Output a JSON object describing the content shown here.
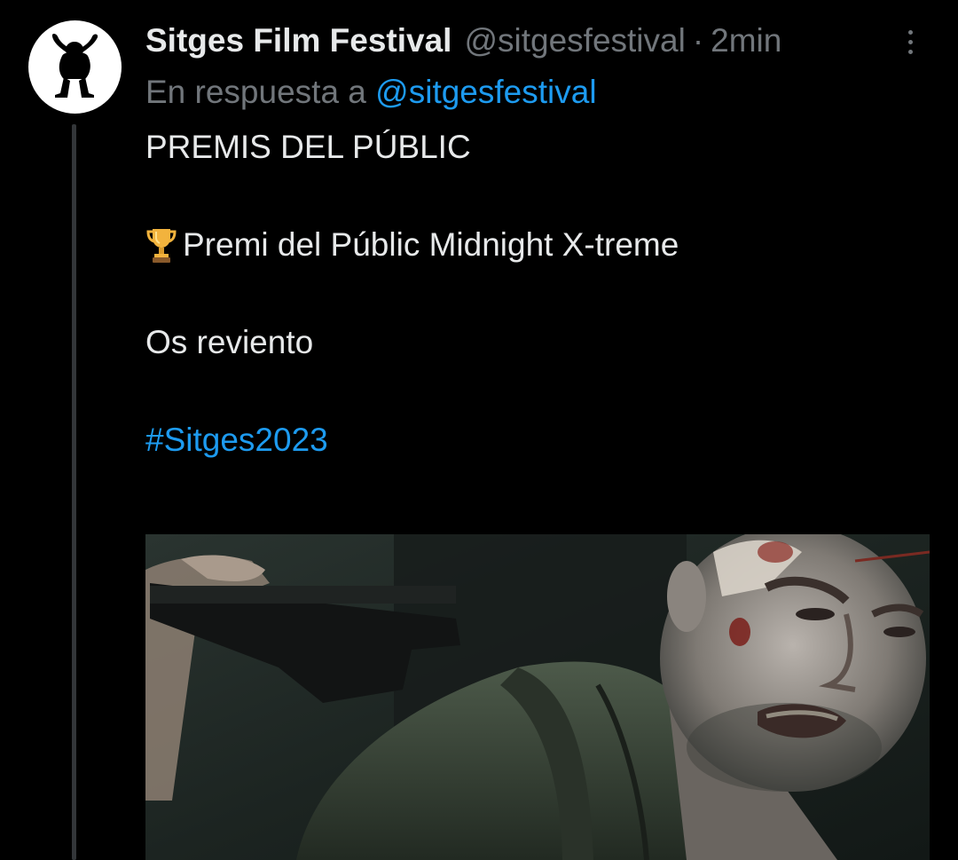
{
  "tweet": {
    "display_name": "Sitges Film Festival",
    "handle": "@sitgesfestival",
    "separator": "·",
    "time": "2min",
    "reply_prefix": "En respuesta a",
    "reply_to": "@sitgesfestival",
    "lines": [
      "PREMIS DEL PÚBLIC",
      "Premi del Públic Midnight X-treme",
      "Os reviento",
      "#Sitges2023"
    ]
  },
  "icons": {
    "avatar": "gorilla-logo-icon",
    "more": "more-vertical-icon",
    "trophy": "trophy-icon"
  },
  "colors": {
    "background": "#000000",
    "text_primary": "#e7e9ea",
    "text_secondary": "#71767b",
    "link": "#1d9bf0",
    "thread_line": "#333639"
  }
}
